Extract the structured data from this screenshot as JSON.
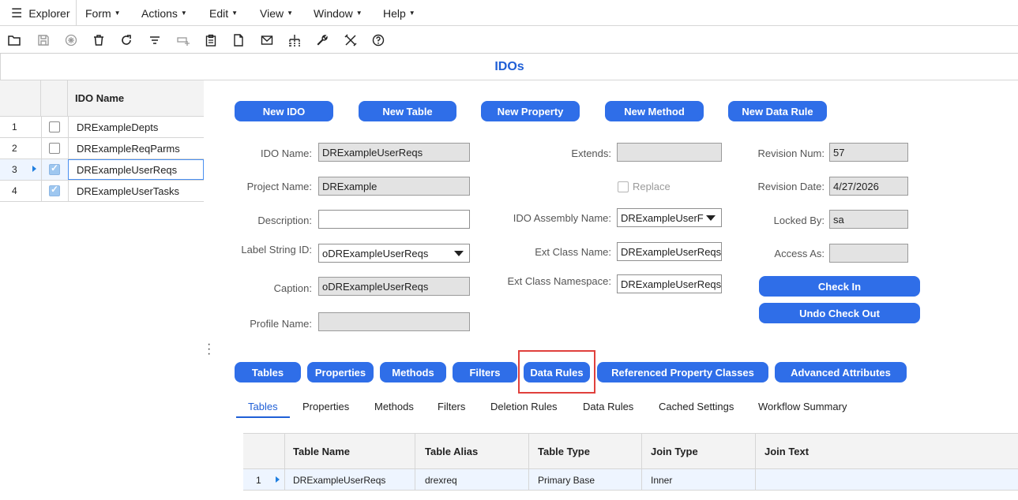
{
  "menubar": {
    "explorer": "Explorer",
    "menus": [
      "Form",
      "Actions",
      "Edit",
      "View",
      "Window",
      "Help"
    ]
  },
  "toolbar": {
    "icons": [
      "open-icon",
      "save-icon",
      "new-record-icon",
      "delete-icon",
      "refresh-icon",
      "filter-icon",
      "filter-in-place-icon",
      "clipboard-icon",
      "document-icon",
      "mail-icon",
      "hierarchy-icon",
      "wrench-icon",
      "tools-icon",
      "help-icon"
    ]
  },
  "form_title": "IDOs",
  "left_grid": {
    "header": "IDO Name",
    "rows": [
      {
        "num": "1",
        "name": "DRExampleDepts",
        "checked": false
      },
      {
        "num": "2",
        "name": "DRExampleReqParms",
        "checked": false
      },
      {
        "num": "3",
        "name": "DRExampleUserReqs",
        "checked": true,
        "selected": true
      },
      {
        "num": "4",
        "name": "DRExampleUserTasks",
        "checked": true
      }
    ]
  },
  "top_buttons": [
    "New IDO",
    "New Table",
    "New Property",
    "New Method",
    "New Data Rule"
  ],
  "fields": {
    "ido_name": {
      "label": "IDO Name:",
      "value": "DRExampleUserReqs"
    },
    "project_name": {
      "label": "Project Name:",
      "value": "DRExample"
    },
    "description": {
      "label": "Description:",
      "value": ""
    },
    "label_string_id": {
      "label": "Label String ID:",
      "value": "oDRExampleUserReqs"
    },
    "caption": {
      "label": "Caption:",
      "value": "oDRExampleUserReqs"
    },
    "profile_name": {
      "label": "Profile Name:",
      "value": ""
    },
    "extends": {
      "label": "Extends:",
      "value": ""
    },
    "replace": {
      "label": "Replace"
    },
    "ido_assembly_name": {
      "label": "IDO Assembly Name:",
      "value": "DRExampleUserF"
    },
    "ext_class_name": {
      "label": "Ext Class Name:",
      "value": "DRExampleUserReqs"
    },
    "ext_class_namespace": {
      "label": "Ext Class Namespace:",
      "value": "DRExampleUserReqs"
    },
    "revision_num": {
      "label": "Revision Num:",
      "value": "57"
    },
    "revision_date": {
      "label": "Revision Date:",
      "value": "4/27/2026"
    },
    "locked_by": {
      "label": "Locked By:",
      "value": "sa"
    },
    "access_as": {
      "label": "Access As:",
      "value": ""
    }
  },
  "side_buttons": {
    "check_in": "Check In",
    "undo_check_out": "Undo Check Out"
  },
  "section_buttons": [
    "Tables",
    "Properties",
    "Methods",
    "Filters",
    "Data Rules",
    "Referenced Property Classes",
    "Advanced Attributes"
  ],
  "tabs": [
    "Tables",
    "Properties",
    "Methods",
    "Filters",
    "Deletion Rules",
    "Data Rules",
    "Cached Settings",
    "Workflow Summary"
  ],
  "active_tab": "Tables",
  "tables_grid": {
    "headers": [
      "Table Name",
      "Table Alias",
      "Table Type",
      "Join Type",
      "Join Text"
    ],
    "rows": [
      {
        "num": "1",
        "cells": [
          "DRExampleUserReqs",
          "drexreq",
          "Primary Base",
          "Inner",
          ""
        ]
      }
    ]
  },
  "colors": {
    "accent": "#2f6ee8",
    "title": "#1f5fd6",
    "highlight": "#e0403c"
  }
}
